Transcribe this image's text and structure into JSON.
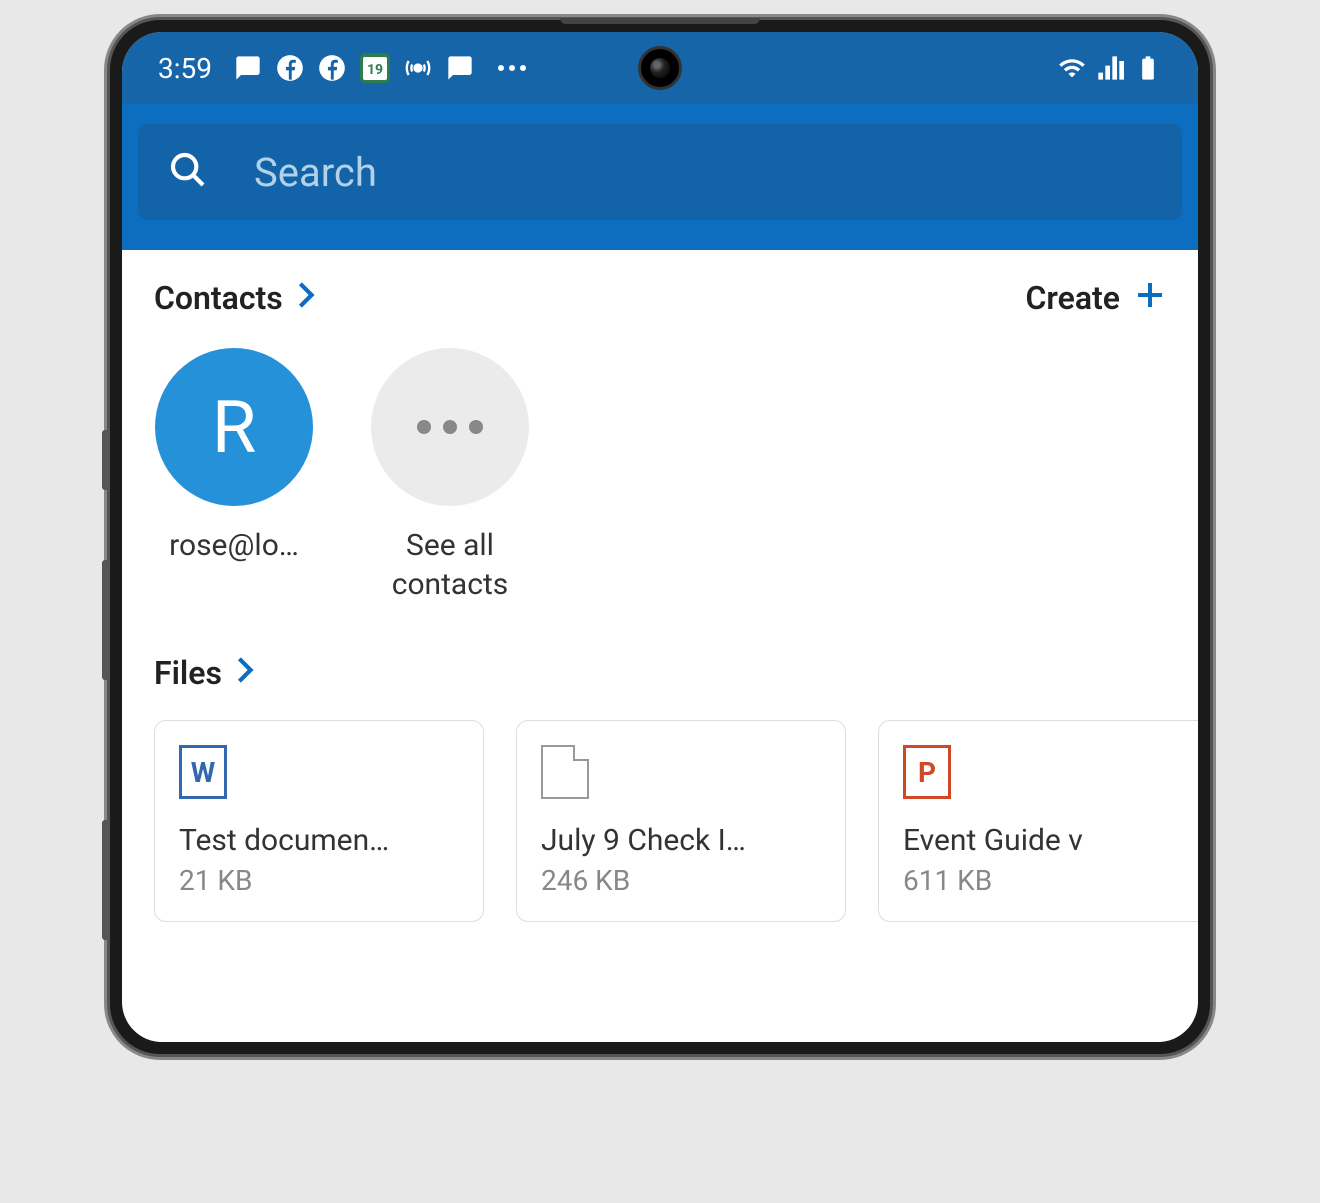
{
  "statusBar": {
    "time": "3:59",
    "calendarDate": "19"
  },
  "search": {
    "placeholder": "Search"
  },
  "contacts": {
    "title": "Contacts",
    "createLabel": "Create",
    "items": [
      {
        "initial": "R",
        "label": "rose@lo…"
      }
    ],
    "seeAllLabel": "See all contacts"
  },
  "files": {
    "title": "Files",
    "items": [
      {
        "type": "word",
        "iconLetter": "W",
        "name": "Test documen…",
        "size": "21 KB"
      },
      {
        "type": "blank",
        "iconLetter": "",
        "name": "July 9 Check I…",
        "size": "246 KB"
      },
      {
        "type": "ppt",
        "iconLetter": "P",
        "name": "Event Guide v",
        "size": "611 KB"
      }
    ]
  }
}
